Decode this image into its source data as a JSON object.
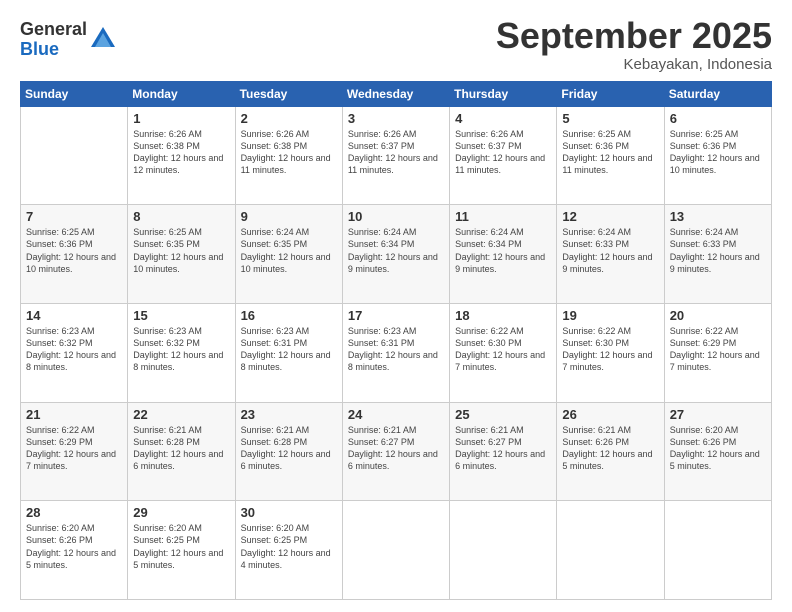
{
  "logo": {
    "general": "General",
    "blue": "Blue"
  },
  "header": {
    "month": "September 2025",
    "location": "Kebayakan, Indonesia"
  },
  "days_of_week": [
    "Sunday",
    "Monday",
    "Tuesday",
    "Wednesday",
    "Thursday",
    "Friday",
    "Saturday"
  ],
  "weeks": [
    [
      {
        "day": "",
        "sunrise": "",
        "sunset": "",
        "daylight": ""
      },
      {
        "day": "1",
        "sunrise": "Sunrise: 6:26 AM",
        "sunset": "Sunset: 6:38 PM",
        "daylight": "Daylight: 12 hours and 12 minutes."
      },
      {
        "day": "2",
        "sunrise": "Sunrise: 6:26 AM",
        "sunset": "Sunset: 6:38 PM",
        "daylight": "Daylight: 12 hours and 11 minutes."
      },
      {
        "day": "3",
        "sunrise": "Sunrise: 6:26 AM",
        "sunset": "Sunset: 6:37 PM",
        "daylight": "Daylight: 12 hours and 11 minutes."
      },
      {
        "day": "4",
        "sunrise": "Sunrise: 6:26 AM",
        "sunset": "Sunset: 6:37 PM",
        "daylight": "Daylight: 12 hours and 11 minutes."
      },
      {
        "day": "5",
        "sunrise": "Sunrise: 6:25 AM",
        "sunset": "Sunset: 6:36 PM",
        "daylight": "Daylight: 12 hours and 11 minutes."
      },
      {
        "day": "6",
        "sunrise": "Sunrise: 6:25 AM",
        "sunset": "Sunset: 6:36 PM",
        "daylight": "Daylight: 12 hours and 10 minutes."
      }
    ],
    [
      {
        "day": "7",
        "sunrise": "Sunrise: 6:25 AM",
        "sunset": "Sunset: 6:36 PM",
        "daylight": "Daylight: 12 hours and 10 minutes."
      },
      {
        "day": "8",
        "sunrise": "Sunrise: 6:25 AM",
        "sunset": "Sunset: 6:35 PM",
        "daylight": "Daylight: 12 hours and 10 minutes."
      },
      {
        "day": "9",
        "sunrise": "Sunrise: 6:24 AM",
        "sunset": "Sunset: 6:35 PM",
        "daylight": "Daylight: 12 hours and 10 minutes."
      },
      {
        "day": "10",
        "sunrise": "Sunrise: 6:24 AM",
        "sunset": "Sunset: 6:34 PM",
        "daylight": "Daylight: 12 hours and 9 minutes."
      },
      {
        "day": "11",
        "sunrise": "Sunrise: 6:24 AM",
        "sunset": "Sunset: 6:34 PM",
        "daylight": "Daylight: 12 hours and 9 minutes."
      },
      {
        "day": "12",
        "sunrise": "Sunrise: 6:24 AM",
        "sunset": "Sunset: 6:33 PM",
        "daylight": "Daylight: 12 hours and 9 minutes."
      },
      {
        "day": "13",
        "sunrise": "Sunrise: 6:24 AM",
        "sunset": "Sunset: 6:33 PM",
        "daylight": "Daylight: 12 hours and 9 minutes."
      }
    ],
    [
      {
        "day": "14",
        "sunrise": "Sunrise: 6:23 AM",
        "sunset": "Sunset: 6:32 PM",
        "daylight": "Daylight: 12 hours and 8 minutes."
      },
      {
        "day": "15",
        "sunrise": "Sunrise: 6:23 AM",
        "sunset": "Sunset: 6:32 PM",
        "daylight": "Daylight: 12 hours and 8 minutes."
      },
      {
        "day": "16",
        "sunrise": "Sunrise: 6:23 AM",
        "sunset": "Sunset: 6:31 PM",
        "daylight": "Daylight: 12 hours and 8 minutes."
      },
      {
        "day": "17",
        "sunrise": "Sunrise: 6:23 AM",
        "sunset": "Sunset: 6:31 PM",
        "daylight": "Daylight: 12 hours and 8 minutes."
      },
      {
        "day": "18",
        "sunrise": "Sunrise: 6:22 AM",
        "sunset": "Sunset: 6:30 PM",
        "daylight": "Daylight: 12 hours and 7 minutes."
      },
      {
        "day": "19",
        "sunrise": "Sunrise: 6:22 AM",
        "sunset": "Sunset: 6:30 PM",
        "daylight": "Daylight: 12 hours and 7 minutes."
      },
      {
        "day": "20",
        "sunrise": "Sunrise: 6:22 AM",
        "sunset": "Sunset: 6:29 PM",
        "daylight": "Daylight: 12 hours and 7 minutes."
      }
    ],
    [
      {
        "day": "21",
        "sunrise": "Sunrise: 6:22 AM",
        "sunset": "Sunset: 6:29 PM",
        "daylight": "Daylight: 12 hours and 7 minutes."
      },
      {
        "day": "22",
        "sunrise": "Sunrise: 6:21 AM",
        "sunset": "Sunset: 6:28 PM",
        "daylight": "Daylight: 12 hours and 6 minutes."
      },
      {
        "day": "23",
        "sunrise": "Sunrise: 6:21 AM",
        "sunset": "Sunset: 6:28 PM",
        "daylight": "Daylight: 12 hours and 6 minutes."
      },
      {
        "day": "24",
        "sunrise": "Sunrise: 6:21 AM",
        "sunset": "Sunset: 6:27 PM",
        "daylight": "Daylight: 12 hours and 6 minutes."
      },
      {
        "day": "25",
        "sunrise": "Sunrise: 6:21 AM",
        "sunset": "Sunset: 6:27 PM",
        "daylight": "Daylight: 12 hours and 6 minutes."
      },
      {
        "day": "26",
        "sunrise": "Sunrise: 6:21 AM",
        "sunset": "Sunset: 6:26 PM",
        "daylight": "Daylight: 12 hours and 5 minutes."
      },
      {
        "day": "27",
        "sunrise": "Sunrise: 6:20 AM",
        "sunset": "Sunset: 6:26 PM",
        "daylight": "Daylight: 12 hours and 5 minutes."
      }
    ],
    [
      {
        "day": "28",
        "sunrise": "Sunrise: 6:20 AM",
        "sunset": "Sunset: 6:26 PM",
        "daylight": "Daylight: 12 hours and 5 minutes."
      },
      {
        "day": "29",
        "sunrise": "Sunrise: 6:20 AM",
        "sunset": "Sunset: 6:25 PM",
        "daylight": "Daylight: 12 hours and 5 minutes."
      },
      {
        "day": "30",
        "sunrise": "Sunrise: 6:20 AM",
        "sunset": "Sunset: 6:25 PM",
        "daylight": "Daylight: 12 hours and 4 minutes."
      },
      {
        "day": "",
        "sunrise": "",
        "sunset": "",
        "daylight": ""
      },
      {
        "day": "",
        "sunrise": "",
        "sunset": "",
        "daylight": ""
      },
      {
        "day": "",
        "sunrise": "",
        "sunset": "",
        "daylight": ""
      },
      {
        "day": "",
        "sunrise": "",
        "sunset": "",
        "daylight": ""
      }
    ]
  ]
}
